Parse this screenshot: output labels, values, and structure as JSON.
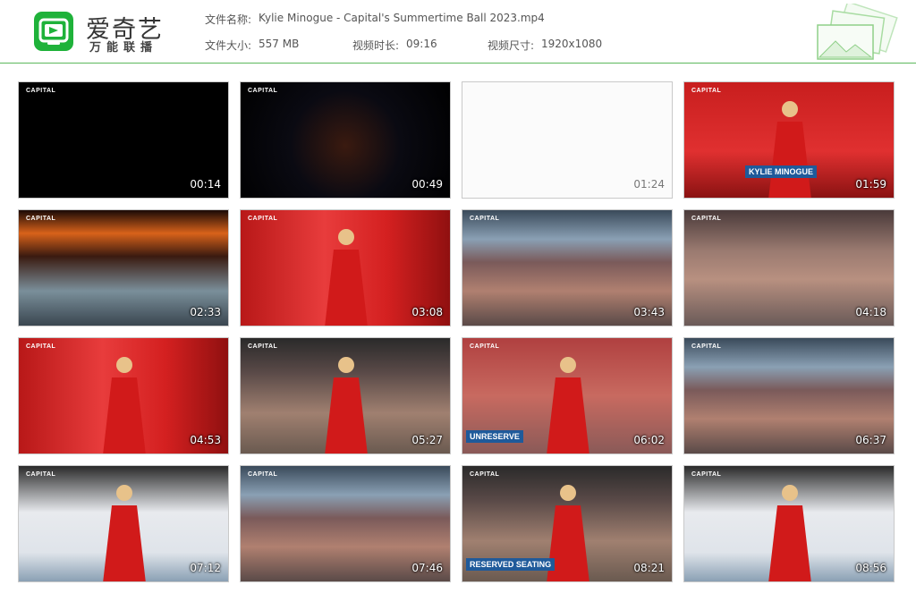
{
  "brand": {
    "title": "爱奇艺",
    "subtitle": "万能联播",
    "logo_icon": "iqiyi-tv-logo-icon",
    "accent": "#1fb23a"
  },
  "file": {
    "name_label": "文件名称:",
    "name_value": "Kylie Minogue - Capital's Summertime Ball 2023.mp4",
    "size_label": "文件大小:",
    "size_value": "557 MB",
    "duration_label": "视频时长:",
    "duration_value": "09:16",
    "resolution_label": "视频尺寸:",
    "resolution_value": "1920x1080"
  },
  "thumbnails": [
    {
      "timestamp": "00:14",
      "capital": "CAPITAL",
      "scene": "black"
    },
    {
      "timestamp": "00:49",
      "capital": "CAPITAL",
      "scene": "space"
    },
    {
      "timestamp": "01:24",
      "capital": "",
      "scene": "white"
    },
    {
      "timestamp": "01:59",
      "capital": "CAPITAL",
      "scene": "stage-red",
      "overlay_text": "KYLIE MINOGUE"
    },
    {
      "timestamp": "02:33",
      "capital": "CAPITAL",
      "scene": "runway"
    },
    {
      "timestamp": "03:08",
      "capital": "CAPITAL",
      "scene": "dancers"
    },
    {
      "timestamp": "03:43",
      "capital": "CAPITAL",
      "scene": "stadium"
    },
    {
      "timestamp": "04:18",
      "capital": "CAPITAL",
      "scene": "crowd"
    },
    {
      "timestamp": "04:53",
      "capital": "CAPITAL",
      "scene": "dancers"
    },
    {
      "timestamp": "05:27",
      "capital": "CAPITAL",
      "scene": "singer-crowd"
    },
    {
      "timestamp": "06:02",
      "capital": "CAPITAL",
      "scene": "singer-closeup",
      "overlay_text": "UNRESERVE"
    },
    {
      "timestamp": "06:37",
      "capital": "CAPITAL",
      "scene": "stadium"
    },
    {
      "timestamp": "07:12",
      "capital": "CAPITAL",
      "scene": "singer-stage"
    },
    {
      "timestamp": "07:46",
      "capital": "CAPITAL",
      "scene": "stadium"
    },
    {
      "timestamp": "08:21",
      "capital": "CAPITAL",
      "scene": "singer-crowd",
      "overlay_text": "RESERVED SEATING"
    },
    {
      "timestamp": "08:56",
      "capital": "CAPITAL",
      "scene": "singer-stage"
    }
  ]
}
